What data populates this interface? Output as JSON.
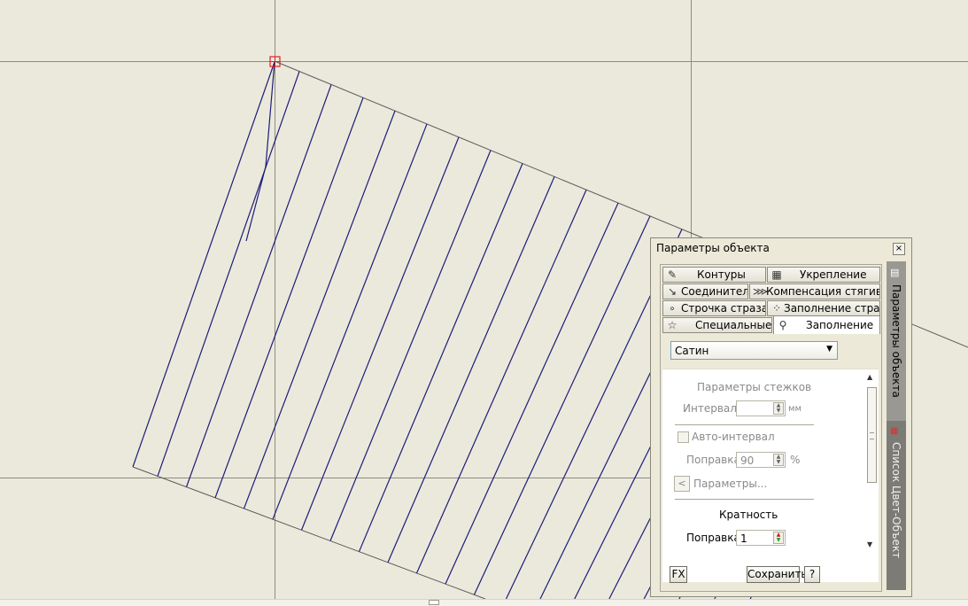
{
  "panel": {
    "title": "Параметры объекта",
    "close_glyph": "×",
    "tabs": [
      {
        "label": "Контуры",
        "icon": "contour-icon"
      },
      {
        "label": "Укрепление",
        "icon": "underlay-icon"
      },
      {
        "label": "Соединители",
        "icon": "connectors-icon"
      },
      {
        "label": "Компенсация стягива...",
        "icon": "pull-compensation-icon"
      },
      {
        "label": "Строчка страза...",
        "icon": "rhinestone-run-icon"
      },
      {
        "label": "Заполнение страз...",
        "icon": "rhinestone-fill-icon"
      },
      {
        "label": "Специальные",
        "icon": "star-icon"
      },
      {
        "label": "Заполнение",
        "icon": "fill-icon"
      }
    ],
    "fill_type": "Сатин",
    "stitch_params": {
      "heading": "Параметры стежков",
      "interval_label": "Интервал:",
      "interval_value": "",
      "interval_unit": "мм",
      "auto_interval_label": "Авто-интервал",
      "correction_label": "Поправка",
      "correction_value": "90",
      "correction_unit": "%",
      "params_button": "Параметры..."
    },
    "multiplicity": {
      "heading": "Кратность",
      "correction_label": "Поправка",
      "correction_value": "1"
    },
    "footer": {
      "fx": "FX",
      "save": "Сохранить",
      "help": "?"
    },
    "side_tabs": [
      "Параметры объекта",
      "Список Цвет-Объект"
    ]
  }
}
